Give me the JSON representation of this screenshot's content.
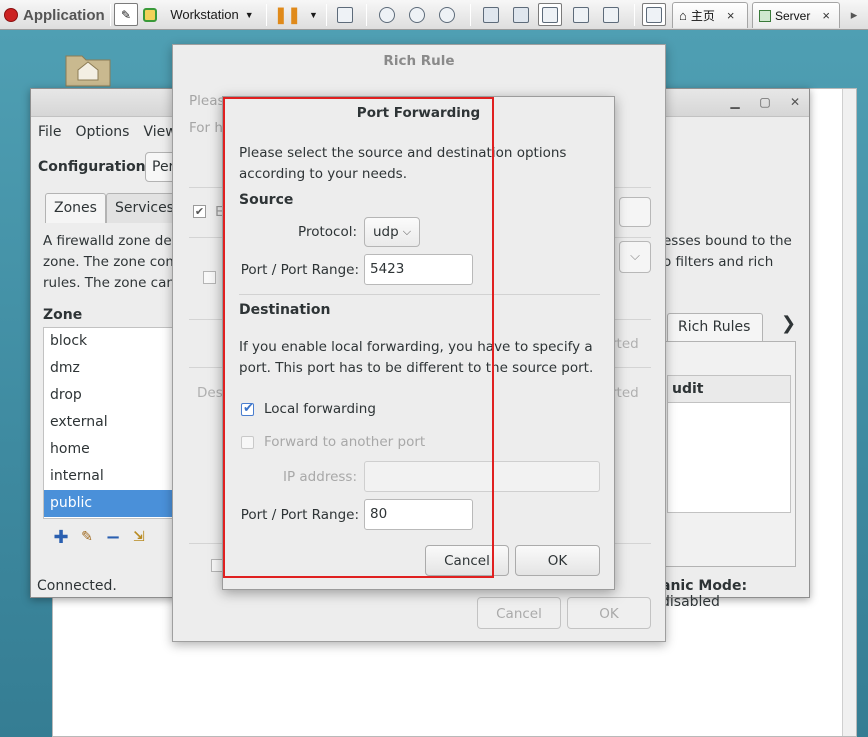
{
  "topbar": {
    "apps_label": "Application",
    "vm_name": "Workstation",
    "tabs": [
      {
        "label": "主页",
        "close": "×"
      },
      {
        "label": "Server",
        "close": "×"
      }
    ]
  },
  "fw_window": {
    "menu": [
      "File",
      "Options",
      "View"
    ],
    "config_label": "Configuration:",
    "config_value": "Per",
    "tabs": [
      "Zones",
      "Services"
    ],
    "description_left": [
      "A firewalld zone def",
      "zone. The zone com",
      "rules. The zone can"
    ],
    "description_right": [
      "esses bound to the",
      "o filters and rich"
    ],
    "zone_header": "Zone",
    "zones": [
      "block",
      "dmz",
      "drop",
      "external",
      "home",
      "internal",
      "public"
    ],
    "selected_zone": "public",
    "rich_rules_tab": "Rich Rules",
    "tab_next": "❯",
    "audit_header": "udit",
    "status": "Connected.",
    "panic_label": "anic Mode:",
    "panic_value": "disabled"
  },
  "rich_dialog": {
    "title": "Rich Rule",
    "please_partial": "Pleas",
    "for_partial": "For h",
    "enable_partial": "E",
    "dest_partial": "Des",
    "inverted_1": "rted",
    "inverted_2": "rted",
    "combo_arrow": "⌵",
    "cancel": "Cancel",
    "ok": "OK"
  },
  "pf_dialog": {
    "title": "Port Forwarding",
    "intro_1": "Please select the source and destination options",
    "intro_2": "according to your needs.",
    "source_header": "Source",
    "protocol_label": "Protocol:",
    "protocol_value": "udp",
    "source_port_label": "Port / Port Range:",
    "source_port_value": "5423",
    "destination_header": "Destination",
    "dest_text_1": "If you enable local forwarding, you have to specify a",
    "dest_text_2": "port. This port has to be different to the source port.",
    "local_forwarding_label": "Local forwarding",
    "local_forwarding_checked": true,
    "forward_other_label": "Forward to another port",
    "forward_other_checked": false,
    "ip_label": "IP address:",
    "ip_value": "",
    "dest_port_label": "Port / Port Range:",
    "dest_port_value": "80",
    "cancel": "Cancel",
    "ok": "OK"
  },
  "colors": {
    "desktop": "#3f8fa3",
    "selection": "#4a90d9",
    "annotation": "#e02020"
  }
}
